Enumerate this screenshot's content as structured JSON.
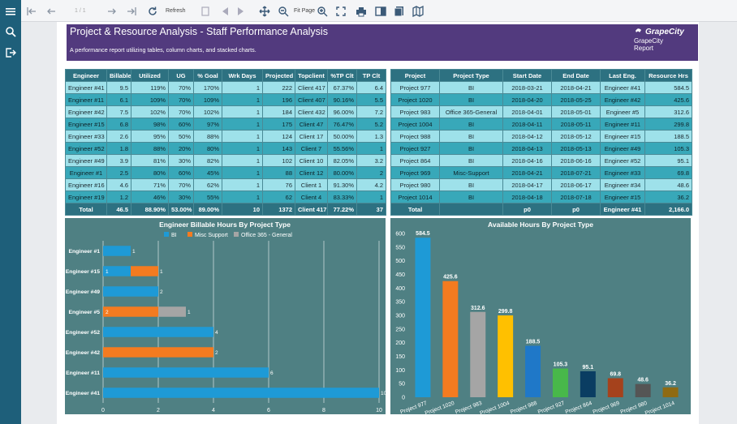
{
  "toolbar": {
    "page_indicator": "1 / 1",
    "refresh_label": "Refresh",
    "zoom_label": "Fit Page"
  },
  "report": {
    "title": "Project & Resource Analysis - Staff Performance Analysis",
    "subtitle": "A performance report utilizing tables, column charts, and stacked charts.",
    "logo_brand": "GrapeCity",
    "logo_line1": "GrapeCity",
    "logo_line2": "Report"
  },
  "colors": {
    "sidebar": "#1e5f7a",
    "banner": "#523a7e",
    "chart_bg": "#4f8083",
    "header": "#2d7181",
    "row_light": "#9ee1ea",
    "row_dark": "#38a8b9"
  },
  "engineer_table": {
    "headers": [
      "Engineer",
      "Billable",
      "Utilized",
      "UG",
      "% Goal",
      "Wrk Days",
      "Projected",
      "Topclient",
      "%TP Clt",
      "TP Clt"
    ],
    "rows": [
      [
        "Engineer #41",
        "9.5",
        "119%",
        "70%",
        "170%",
        "1",
        "222",
        "Client 417",
        "67.37%",
        "6.4"
      ],
      [
        "Engineer #11",
        "6.1",
        "109%",
        "70%",
        "109%",
        "1",
        "196",
        "Client 407",
        "90.16%",
        "5.5"
      ],
      [
        "Engineer #42",
        "7.5",
        "102%",
        "70%",
        "102%",
        "1",
        "184",
        "Client 432",
        "96.00%",
        "7.2"
      ],
      [
        "Engineer #15",
        "6.8",
        "98%",
        "60%",
        "97%",
        "1",
        "175",
        "Client 47",
        "76.47%",
        "5.2"
      ],
      [
        "Engineer #33",
        "2.6",
        "95%",
        "50%",
        "88%",
        "1",
        "124",
        "Client 17",
        "50.00%",
        "1.3"
      ],
      [
        "Engineer #52",
        "1.8",
        "88%",
        "20%",
        "80%",
        "1",
        "143",
        "Client 7",
        "55.56%",
        "1"
      ],
      [
        "Engineer #49",
        "3.9",
        "81%",
        "30%",
        "82%",
        "1",
        "102",
        "Client 10",
        "82.05%",
        "3.2"
      ],
      [
        "Engineer #1",
        "2.5",
        "80%",
        "60%",
        "45%",
        "1",
        "88",
        "Client 12",
        "80.00%",
        "2"
      ],
      [
        "Engineer #16",
        "4.6",
        "71%",
        "70%",
        "62%",
        "1",
        "76",
        "Client 1",
        "91.30%",
        "4.2"
      ],
      [
        "Engineer #19",
        "1.2",
        "46%",
        "30%",
        "55%",
        "1",
        "62",
        "Client 4",
        "83.33%",
        "1"
      ]
    ],
    "total": [
      "Total",
      "46.5",
      "88.90%",
      "53.00%",
      "89.00%",
      "10",
      "1372",
      "Client 417",
      "77.22%",
      "37"
    ]
  },
  "project_table": {
    "headers": [
      "Project",
      "Project Type",
      "Start Date",
      "End Date",
      "Last Eng.",
      "Resource Hrs"
    ],
    "rows": [
      [
        "Project 977",
        "BI",
        "2018-03-21",
        "2018-04-21",
        "Engineer #41",
        "584.5"
      ],
      [
        "Project 1020",
        "BI",
        "2018-04-20",
        "2018-05-25",
        "Engineer #42",
        "425.6"
      ],
      [
        "Project 983",
        "Office 365-General",
        "2018-04-01",
        "2018-05-01",
        "Engineer #5",
        "312.6"
      ],
      [
        "Project 1004",
        "BI",
        "2018-04-11",
        "2018-05-11",
        "Engineer #11",
        "299.8"
      ],
      [
        "Project 988",
        "BI",
        "2018-04-12",
        "2018-05-12",
        "Engineer #15",
        "188.5"
      ],
      [
        "Project 927",
        "BI",
        "2018-04-13",
        "2018-05-13",
        "Engineer #49",
        "105.3"
      ],
      [
        "Project 864",
        "BI",
        "2018-04-16",
        "2018-06-16",
        "Engineer #52",
        "95.1"
      ],
      [
        "Project 969",
        "Misc-Support",
        "2018-04-21",
        "2018-07-21",
        "Engineer #33",
        "69.8"
      ],
      [
        "Project 980",
        "BI",
        "2018-04-17",
        "2018-06-17",
        "Engineer #34",
        "48.6"
      ],
      [
        "Project 1014",
        "BI",
        "2018-04-18",
        "2018-07-18",
        "Engineer #15",
        "36.2"
      ]
    ],
    "total": [
      "Total",
      "",
      "p0",
      "p0",
      "Engineer #41",
      "2,166.0"
    ]
  },
  "chart_data": [
    {
      "type": "bar",
      "orientation": "horizontal",
      "stacked": true,
      "title": "Engineer Billable Hours By Project Type",
      "legend_placement": "top",
      "grid": true,
      "categories": [
        "Engineer #1",
        "Engineer #15",
        "Engineer #49",
        "Engineer #5",
        "Engineer #52",
        "Engineer #42",
        "Engineer #11",
        "Engineer #41"
      ],
      "series": [
        {
          "name": "BI",
          "color": "#1e9ad6",
          "values": [
            1,
            1,
            2,
            0,
            4,
            0,
            6,
            10
          ]
        },
        {
          "name": "Misc Support",
          "color": "#f47b20",
          "values": [
            0,
            1,
            0,
            2,
            0,
            4,
            0,
            0
          ]
        },
        {
          "name": "Office 365 - General",
          "color": "#a5a5a5",
          "values": [
            0,
            0,
            0,
            1,
            0,
            0,
            0,
            0
          ]
        }
      ],
      "bar_labels": [
        [
          "1"
        ],
        [
          "1",
          "1"
        ],
        [
          "2"
        ],
        [
          "2",
          "1"
        ],
        [
          "4"
        ],
        [
          "2",
          "4"
        ],
        [
          "6"
        ],
        [
          "10"
        ]
      ],
      "xlim": [
        0,
        10
      ],
      "xticks": [
        "0",
        "2",
        "4",
        "6",
        "8",
        "10"
      ]
    },
    {
      "type": "bar",
      "title": "Available Hours By Project Type",
      "grid": false,
      "categories": [
        "Project 977",
        "Project 1020",
        "Project 983",
        "Project 1004",
        "Project 988",
        "Project 927",
        "Project 864",
        "Project 969",
        "Project 980",
        "Project 1014"
      ],
      "values": [
        584.5,
        425.6,
        312.6,
        299.8,
        188.5,
        105.3,
        95.1,
        69.8,
        48.6,
        36.2
      ],
      "value_labels": [
        "584.5",
        "425.6",
        "312.6",
        "299.8",
        "188.5",
        "105.3",
        "95.1",
        "69.8",
        "48.6",
        "36.2"
      ],
      "colors": [
        "#1e9ad6",
        "#f47b20",
        "#a5a5a5",
        "#ffc000",
        "#1f78c8",
        "#48b84a",
        "#0a3d62",
        "#a5421c",
        "#555555",
        "#8f6a12"
      ],
      "ylim": [
        0,
        600
      ],
      "yticks": [
        "0",
        "50",
        "100",
        "150",
        "200",
        "250",
        "300",
        "350",
        "400",
        "450",
        "500",
        "550",
        "600"
      ]
    }
  ]
}
